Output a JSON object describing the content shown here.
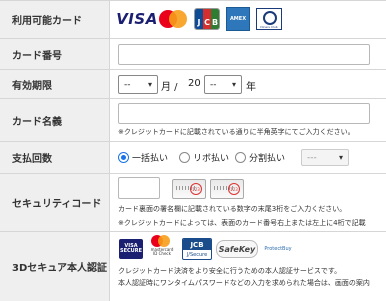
{
  "rows": {
    "brands": {
      "label": "利用可能カード",
      "logos": [
        {
          "name": "visa-logo",
          "text": "VISA"
        },
        {
          "name": "mastercard-logo"
        },
        {
          "name": "jcb-logo",
          "letters": [
            "J",
            "C",
            "B"
          ],
          "colors": [
            "#0e4c96",
            "#d32f2f",
            "#2e7d32"
          ]
        },
        {
          "name": "amex-logo",
          "text": "AMEX"
        },
        {
          "name": "diners-club-logo",
          "text": "Diners Club"
        }
      ]
    },
    "card_number": {
      "label": "カード番号",
      "value": "",
      "placeholder": ""
    },
    "expiry": {
      "label": "有効期限",
      "month_value": "--",
      "month_unit": "月 /",
      "year_prefix": "20",
      "year_value": "--",
      "year_unit": "年"
    },
    "card_name": {
      "label": "カード名義",
      "value": "",
      "placeholder": "",
      "note": "※クレジットカードに記載されている通りに半角英字にてご入力ください。"
    },
    "payment": {
      "label": "支払回数",
      "options": [
        {
          "label": "一括払い",
          "selected": true
        },
        {
          "label": "リボ払い",
          "selected": false
        },
        {
          "label": "分割払い",
          "selected": false
        }
      ],
      "installments_value": "---"
    },
    "security": {
      "label": "セキュリティコード",
      "value": "",
      "note1": "カード裏面の署名欄に記載されている数字の末尾3桁をご入力ください。",
      "note2": "※クレジットカードによっては、表面のカード番号右上または左上に4桁で記載"
    },
    "secure3d": {
      "label": "3Dセキュア本人認証",
      "logos": {
        "visa_top": "VISA",
        "visa_bottom": "SECURE",
        "mc_text": "mastercard ID Check",
        "jcb_top": "JCB",
        "jcb_bottom": "J/Secure",
        "safekey": "SafeKey",
        "protectbuy": "ProtectBuy"
      },
      "note1": "クレジットカード決済をより安全に行うための本人認証サービスです。",
      "note2": "本人認証時にワンタイムパスワードなどの入力を求められた場合は、画面の案内"
    }
  },
  "colors": {
    "label_bg": "#efefef",
    "border": "#d6d6d6",
    "radio_accent": "#1a73e8"
  }
}
